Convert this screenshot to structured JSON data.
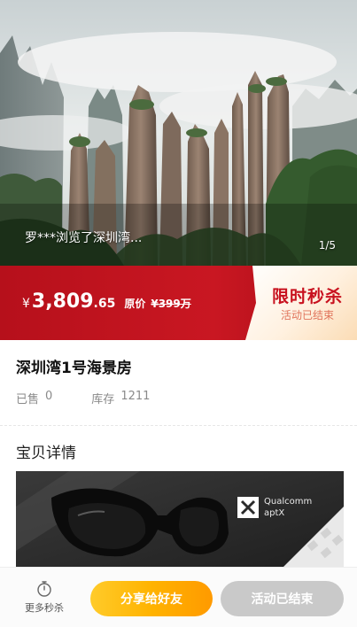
{
  "hero": {
    "viewer_toast": "罗***浏览了深圳湾...",
    "slide_counter": "1/5"
  },
  "flash_sale": {
    "currency": "¥",
    "price_int": "3,809",
    "price_dec": ".65",
    "original_label": "原价",
    "original_value": "¥399万",
    "tag_title": "限时秒杀",
    "tag_status": "活动已结束",
    "colors": {
      "banner": "#c91722",
      "tag_text": "#c8111e"
    }
  },
  "product": {
    "title": "深圳湾1号海景房",
    "sold_label": "已售",
    "sold_value": "0",
    "stock_label": "库存",
    "stock_value": "1211"
  },
  "details": {
    "section_title": "宝贝详情",
    "image_brand_line1": "Qualcomm",
    "image_brand_line2": "aptX"
  },
  "bottom_bar": {
    "more_label": "更多秒杀",
    "more_icon": "stopwatch-icon",
    "share_label": "分享给好友",
    "ended_label": "活动已结束",
    "colors": {
      "share": "#ffb300",
      "ended": "#c9c9c9"
    }
  }
}
